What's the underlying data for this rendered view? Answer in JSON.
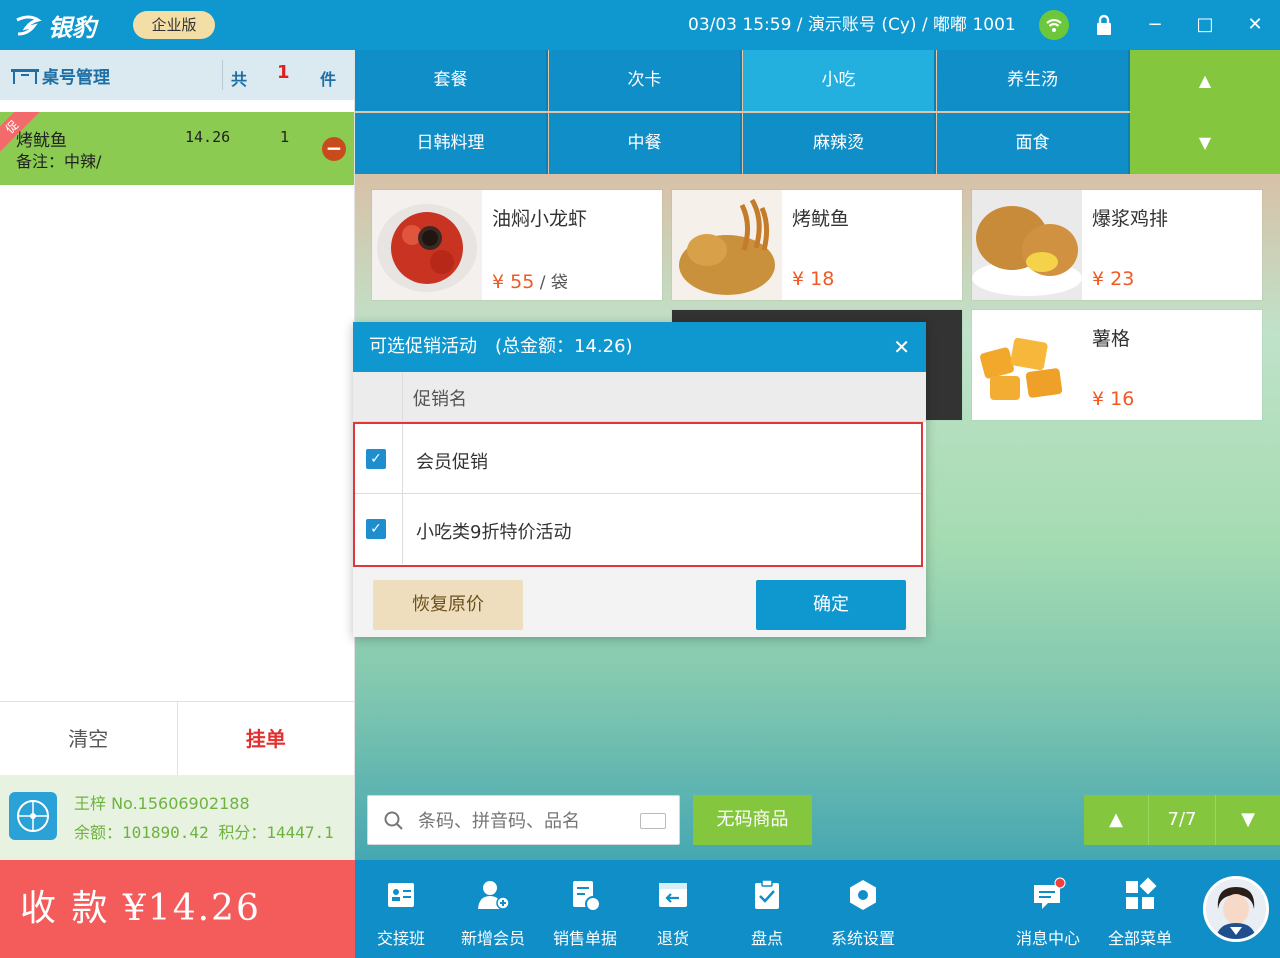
{
  "titlebar": {
    "app_name": "银豹",
    "edition": "企业版",
    "info": "03/03 15:59 / 演示账号 (Cy) / 嘟嘟 1001",
    "minimize": "−",
    "maximize": "□",
    "close": "✕"
  },
  "order": {
    "title": "桌号管理",
    "total_prefix": "共",
    "total_count": "1",
    "total_suffix": "件",
    "promo_tag": "促",
    "item_name": "烤鱿鱼",
    "item_note": "备注：中辣/",
    "item_price": "14.26",
    "item_qty": "1",
    "clear_label": "清空",
    "hold_label": "挂单"
  },
  "member": {
    "line1": "王梓 No.15606902188",
    "line2": "余额：101890.42 积分：14447.1"
  },
  "pay": {
    "label": "收 款 ¥14.26"
  },
  "categories": [
    "套餐",
    "次卡",
    "小吃",
    "养生汤",
    "日韩料理",
    "中餐",
    "麻辣烫",
    "面食"
  ],
  "category_active": "小吃",
  "category_nav": {
    "up": "▲",
    "down": "▼"
  },
  "products": [
    {
      "name": "油焖小龙虾",
      "price": "¥ 55",
      "unit": " / 袋"
    },
    {
      "name": "烤鱿鱼",
      "price": "¥ 18",
      "unit": ""
    },
    {
      "name": "爆浆鸡排",
      "price": "¥ 23",
      "unit": ""
    },
    {
      "name": "薯格",
      "price": "¥ 16",
      "unit": ""
    }
  ],
  "search": {
    "placeholder": "条码、拼音码、品名"
  },
  "no_code_label": "无码商品",
  "pager": {
    "up": "▲",
    "page": "7/7",
    "down": "▼"
  },
  "dialog": {
    "title": "可选促销活动　(总金额：14.26)",
    "close": "✕",
    "column": "促销名",
    "rows": [
      {
        "name": "会员促销",
        "checked": true
      },
      {
        "name": "小吃类9折特价活动",
        "checked": true
      }
    ],
    "restore_label": "恢复原价",
    "confirm_label": "确定"
  },
  "bottom_nav": [
    {
      "label": "交接班",
      "icon": "shift-icon"
    },
    {
      "label": "新增会员",
      "icon": "add-member-icon"
    },
    {
      "label": "销售单据",
      "icon": "sales-doc-icon"
    },
    {
      "label": "退货",
      "icon": "return-icon"
    },
    {
      "label": "盘点",
      "icon": "inventory-icon"
    },
    {
      "label": "系统设置",
      "icon": "settings-icon"
    },
    {
      "label": "消息中心",
      "icon": "message-icon"
    },
    {
      "label": "全部菜单",
      "icon": "all-menu-icon"
    }
  ],
  "colors": {
    "primary": "#0f97d0",
    "green": "#84c73f",
    "pay_red": "#f45b5b",
    "highlight_red": "#e0383a"
  }
}
